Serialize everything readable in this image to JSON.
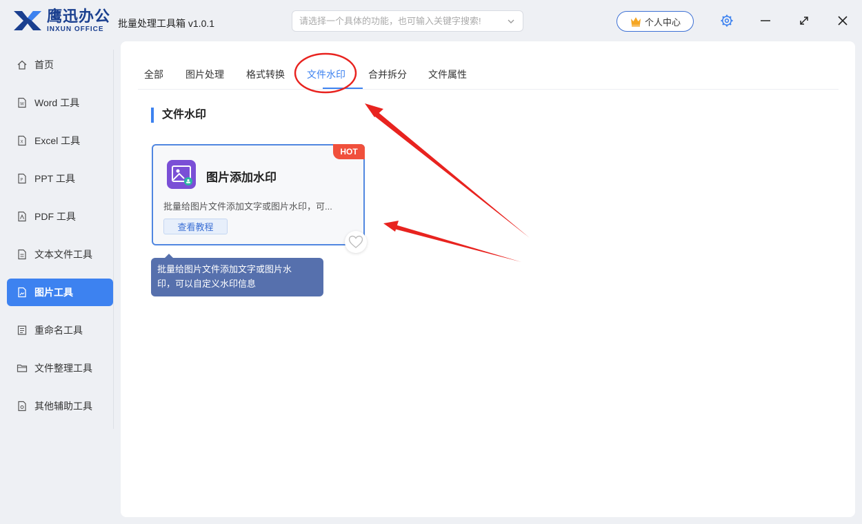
{
  "app": {
    "logo_cn": "鹰迅办公",
    "logo_en": "INXUN OFFICE",
    "title": "批量处理工具箱 v1.0.1",
    "brand_color": "#1a3f8f",
    "accent_color": "#3d82f0"
  },
  "search": {
    "placeholder": "请选择一个具体的功能，也可输入关键字搜索!",
    "value": ""
  },
  "header": {
    "user_center_label": "个人中心"
  },
  "sidebar": {
    "items": [
      {
        "label": "首页",
        "icon": "home-icon"
      },
      {
        "label": "Word 工具",
        "icon": "word-file-icon"
      },
      {
        "label": "Excel 工具",
        "icon": "excel-file-icon"
      },
      {
        "label": "PPT 工具",
        "icon": "ppt-file-icon"
      },
      {
        "label": "PDF 工具",
        "icon": "pdf-file-icon"
      },
      {
        "label": "文本文件工具",
        "icon": "text-file-icon"
      },
      {
        "label": "图片工具",
        "icon": "image-file-icon",
        "active": true
      },
      {
        "label": "重命名工具",
        "icon": "rename-icon"
      },
      {
        "label": "文件整理工具",
        "icon": "folder-icon"
      },
      {
        "label": "其他辅助工具",
        "icon": "misc-file-icon"
      }
    ]
  },
  "tabs": [
    {
      "label": "全部"
    },
    {
      "label": "图片处理"
    },
    {
      "label": "格式转换"
    },
    {
      "label": "文件水印",
      "active": true
    },
    {
      "label": "合并拆分"
    },
    {
      "label": "文件属性"
    }
  ],
  "section": {
    "title": "文件水印"
  },
  "card": {
    "badge": "HOT",
    "title": "图片添加水印",
    "description": "批量给图片文件添加文字或图片水印，可...",
    "link_label": "查看教程",
    "icon": "image-watermark-icon"
  },
  "tooltip": {
    "line1": "批量给图片文件添加文字或图片水",
    "line2": "印，可以自定义水印信息"
  }
}
